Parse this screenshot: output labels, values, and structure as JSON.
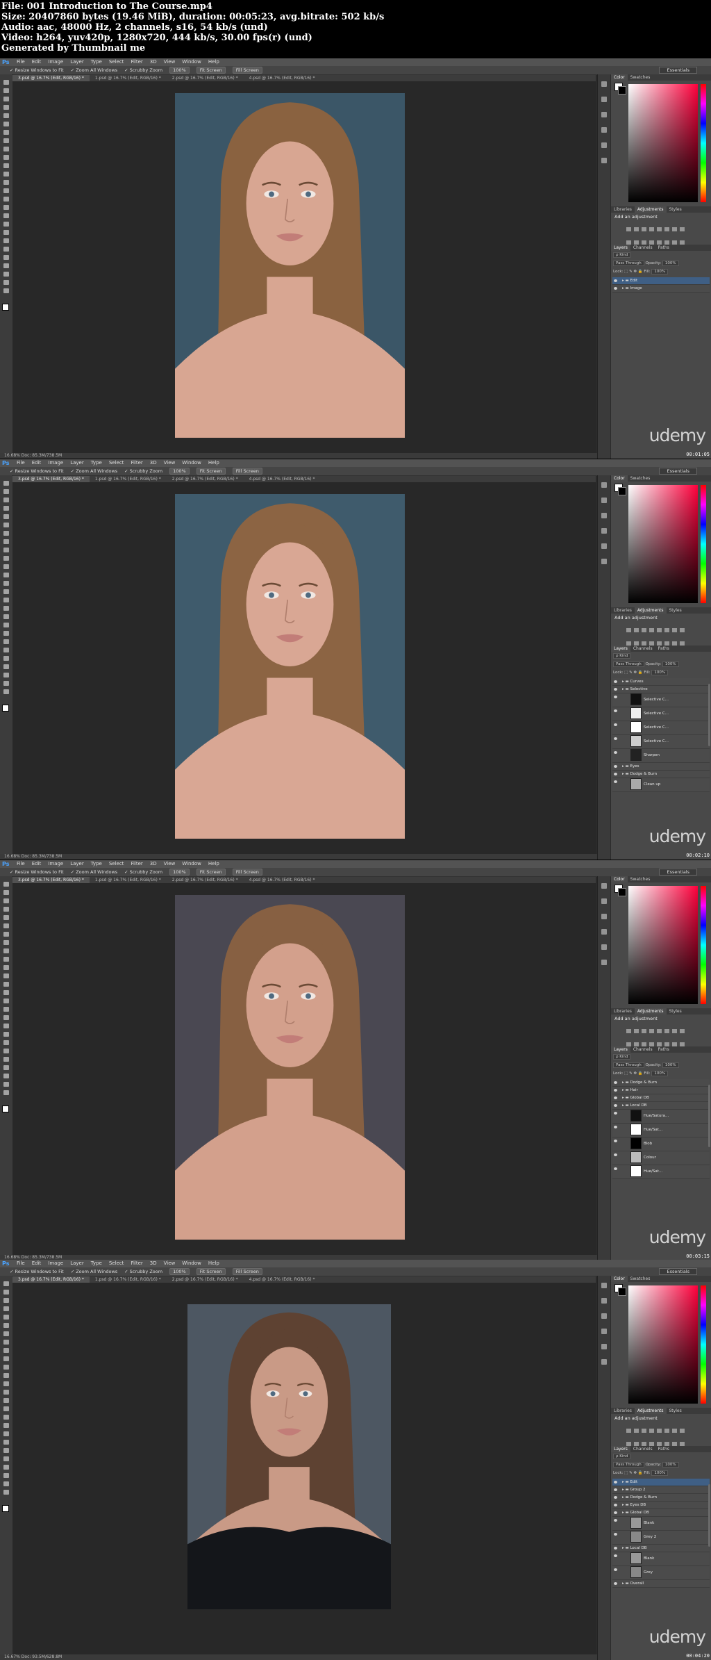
{
  "file_info": {
    "line1": "File: 001 Introduction to The Course.mp4",
    "line2": "Size: 20407860 bytes (19.46 MiB), duration: 00:05:23, avg.bitrate: 502 kb/s",
    "line3": "Audio: aac, 48000 Hz, 2 channels, s16, 54 kb/s (und)",
    "line4": "Video: h264, yuv420p, 1280x720, 444 kb/s, 30.00 fps(r) (und)",
    "line5": "Generated by Thumbnail me"
  },
  "app": {
    "logo": "Ps",
    "menus": [
      "File",
      "Edit",
      "Image",
      "Layer",
      "Type",
      "Select",
      "Filter",
      "3D",
      "View",
      "Window",
      "Help"
    ],
    "options": {
      "resize": "Resize Windows to Fit",
      "zoom_all": "Zoom All Windows",
      "scrubby": "Scrubby Zoom",
      "btn_100": "100%",
      "btn_fit": "Fit Screen",
      "btn_fill": "Fill Screen",
      "workspace": "Essentials"
    },
    "panel_tabs": {
      "color": [
        "Color",
        "Swatches"
      ],
      "adjust": [
        "Libraries",
        "Adjustments",
        "Styles"
      ],
      "layers": [
        "Layers",
        "Channels",
        "Paths"
      ]
    },
    "add_adjustment": "Add an adjustment",
    "layer_controls": {
      "kind": "ρ Kind",
      "blend": "Pass Through",
      "opacity_label": "Opacity:",
      "opacity": "100%",
      "lock_label": "Lock:",
      "fill_label": "Fill:",
      "fill": "100%"
    },
    "brand": "udemy"
  },
  "frames": [
    {
      "tabs": [
        "3.psd @ 16.7% (Edit, RGB/16) *",
        "1.psd @ 16.7% (Edit, RGB/16) *",
        "2.psd @ 16.7% (Edit, RGB/16) *",
        "4.psd @ 16.7% (Edit, RGB/16) *"
      ],
      "status": "16.68%     Doc: 85.3M/738.5M",
      "timestamp": "00:01:05",
      "layers": [
        {
          "name": "Edit",
          "selected": true,
          "folder": true
        },
        {
          "name": "Image",
          "selected": false,
          "folder": true
        }
      ]
    },
    {
      "tabs": [
        "3.psd @ 16.7% (Edit, RGB/16) *",
        "1.psd @ 16.7% (Edit, RGB/16) *",
        "2.psd @ 16.7% (Edit, RGB/16) *",
        "4.psd @ 16.7% (Edit, RGB/16) *"
      ],
      "status": "16.68%     Doc: 85.3M/738.5M",
      "timestamp": "00:02:10",
      "layers": [
        {
          "name": "Curves",
          "folder": true
        },
        {
          "name": "Selective",
          "folder": true
        },
        {
          "name": "Selective C...",
          "tall": true,
          "mask": "#111"
        },
        {
          "name": "Selective C...",
          "tall": true,
          "mask": "#eee"
        },
        {
          "name": "Selective C...",
          "tall": true,
          "mask": "#fff"
        },
        {
          "name": "Selective C...",
          "tall": true,
          "mask": "#ccc"
        },
        {
          "name": "Sharpen",
          "tall": true,
          "mask": "#222"
        },
        {
          "name": "Eyes",
          "folder": true
        },
        {
          "name": "Dodge & Burn",
          "folder": true
        },
        {
          "name": "Clean up",
          "tall": true,
          "mask": "#aaa"
        }
      ]
    },
    {
      "tabs": [
        "3.psd @ 16.7% (Edit, RGB/16) *",
        "1.psd @ 16.7% (Edit, RGB/16) *",
        "2.psd @ 16.7% (Edit, RGB/16) *",
        "4.psd @ 16.7% (Edit, RGB/16) *"
      ],
      "status": "16.68%     Doc: 85.3M/738.5M",
      "timestamp": "00:03:15",
      "layers": [
        {
          "name": "Dodge & Burn",
          "folder": true
        },
        {
          "name": "Hair",
          "folder": true
        },
        {
          "name": "Global DB",
          "folder": true
        },
        {
          "name": "Local DB",
          "folder": true
        },
        {
          "name": "Hue/Satura...",
          "tall": true,
          "mask": "#111"
        },
        {
          "name": "Hue/Sat...",
          "tall": true,
          "mask": "#fff"
        },
        {
          "name": "Blob",
          "tall": true,
          "mask": "#000"
        },
        {
          "name": "Colour",
          "tall": true,
          "mask": "#bbb"
        },
        {
          "name": "Hue/Sat...",
          "tall": true,
          "mask": "#fff"
        }
      ]
    },
    {
      "tabs": [
        "3.psd @ 16.7% (Edit, RGB/16) *",
        "1.psd @ 16.7% (Edit, RGB/16) *",
        "2.psd @ 16.7% (Edit, RGB/16) *",
        "4.psd @ 16.7% (Edit, RGB/16) *"
      ],
      "status": "16.67%     Doc: 93.5M/628.8M",
      "timestamp": "00:04:20",
      "layers": [
        {
          "name": "Edit",
          "selected": true,
          "folder": true
        },
        {
          "name": "Group 2",
          "folder": true
        },
        {
          "name": "Dodge & Burn",
          "folder": true
        },
        {
          "name": "Eyes DB",
          "folder": true
        },
        {
          "name": "Global DB",
          "folder": true
        },
        {
          "name": "Blank",
          "tall": true,
          "mask": "#999"
        },
        {
          "name": "Grey 2",
          "tall": true,
          "mask": "#888"
        },
        {
          "name": "Local DB",
          "folder": true
        },
        {
          "name": "Blank",
          "tall": true,
          "mask": "#999"
        },
        {
          "name": "Grey",
          "tall": true,
          "mask": "#888"
        },
        {
          "name": "Overall",
          "folder": true
        }
      ]
    }
  ]
}
